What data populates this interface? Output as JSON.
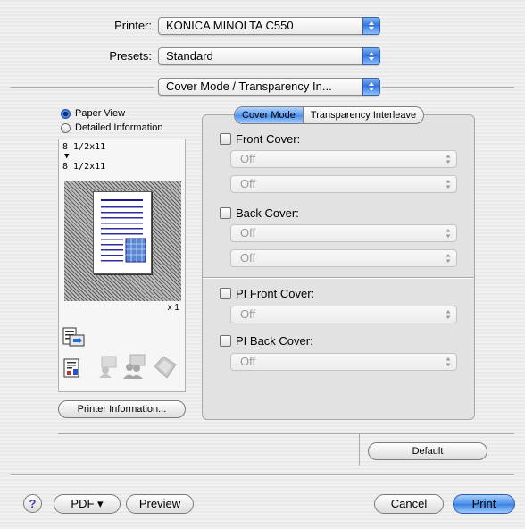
{
  "printer": {
    "label": "Printer:",
    "value": "KONICA MINOLTA C550"
  },
  "presets": {
    "label": "Presets:",
    "value": "Standard"
  },
  "panel_selector": {
    "value": "Cover Mode / Transparency In..."
  },
  "view_options": [
    {
      "label": "Paper View",
      "selected": true
    },
    {
      "label": "Detailed Information",
      "selected": false
    }
  ],
  "preview": {
    "paper_in": "8 1/2x11",
    "arrow": "▼",
    "paper_out": "8 1/2x11",
    "copies": "x 1"
  },
  "printer_information_button": "Printer Information...",
  "tabs": [
    {
      "label": "Cover Mode",
      "selected": true
    },
    {
      "label": "Transparency Interleave",
      "selected": false
    }
  ],
  "cover_mode": {
    "front_cover": {
      "label": "Front Cover:",
      "checked": false,
      "paper_type": "Off",
      "paper_tray": "Off"
    },
    "back_cover": {
      "label": "Back Cover:",
      "checked": false,
      "paper_type": "Off",
      "paper_tray": "Off"
    },
    "pi_front_cover": {
      "label": "PI Front Cover:",
      "checked": false,
      "value": "Off"
    },
    "pi_back_cover": {
      "label": "PI Back Cover:",
      "checked": false,
      "value": "Off"
    }
  },
  "default_button": "Default",
  "footer": {
    "help": "?",
    "pdf": "PDF ▾",
    "preview": "Preview",
    "cancel": "Cancel",
    "print": "Print"
  },
  "colors": {
    "accent": "#3b80e0",
    "panel": "#e2e2e2"
  }
}
